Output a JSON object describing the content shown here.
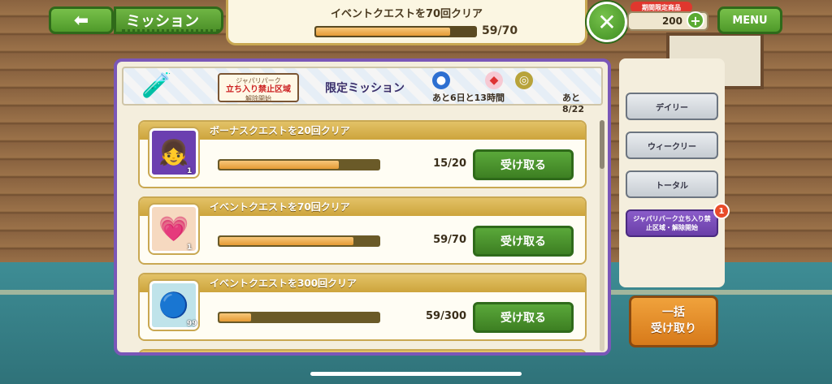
{
  "header": {
    "back_icon": "left-arrow-icon",
    "title": "ミッション"
  },
  "top_banner": {
    "title": "イベントクエストを70回クリア",
    "progress": 0.843,
    "count": "59/70"
  },
  "currency": {
    "limited_label": "期間限定商品",
    "amount": "200"
  },
  "menu_label": "MENU",
  "event_banner": {
    "sign_top": "ジャパリパーク",
    "sign_main": "立ち入り禁止区域",
    "sign_sub": "解除開始",
    "limited_label": "限定ミッション",
    "remaining_time": "あと6日と13時間",
    "remaining_count": "あと8/22"
  },
  "missions": [
    {
      "title": "ボーナスクエストを20回クリア",
      "icon": "character-portrait-icon",
      "qty": "1",
      "progress": 0.75,
      "count": "15/20",
      "button": "受け取る",
      "icon_bg": "#6b3fb0"
    },
    {
      "title": "イベントクエストを70回クリア",
      "icon": "pink-gem-icon",
      "qty": "1",
      "progress": 0.843,
      "count": "59/70",
      "button": "受け取る",
      "icon_bg": "#f6d9c0"
    },
    {
      "title": "イベントクエストを300回クリア",
      "icon": "blue-medal-icon",
      "qty": "99",
      "progress": 0.197,
      "count": "59/300",
      "button": "受け取る",
      "icon_bg": "#bfe3ea"
    }
  ],
  "tabs": [
    {
      "label": "デイリー",
      "active": false
    },
    {
      "label": "ウィークリー",
      "active": false
    },
    {
      "label": "トータル",
      "active": false
    },
    {
      "label": "ジャパリパーク立ち入り禁止区域・解除開始",
      "active": true
    }
  ],
  "tab_badge": "1",
  "bulk_button": {
    "line1": "一括",
    "line2": "受け取り"
  }
}
